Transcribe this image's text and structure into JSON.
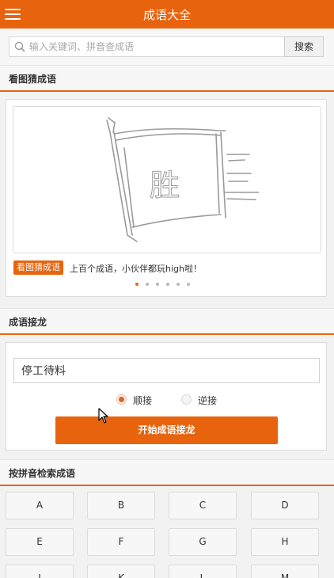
{
  "header": {
    "title": "成语大全",
    "menu_icon": "hamburger-menu-icon"
  },
  "search": {
    "placeholder": "输入关键词、拼音查成语",
    "value": "",
    "button_label": "搜索",
    "icon": "search-icon"
  },
  "guess_section": {
    "title": "看图猜成语",
    "puzzle_text": "胜",
    "tag_label": "看图猜成语",
    "caption": "上百个成语，小伙伴都玩high啦！",
    "carousel": {
      "count": 6,
      "active_index": 0
    }
  },
  "solitaire_section": {
    "title": "成语接龙",
    "input_value": "停工待料",
    "options": [
      {
        "label": "顺接",
        "selected": true
      },
      {
        "label": "逆接",
        "selected": false
      }
    ],
    "start_button_label": "开始成语接龙"
  },
  "pinyin_section": {
    "title": "按拼音检索成语",
    "letters": [
      "A",
      "B",
      "C",
      "D",
      "E",
      "F",
      "G",
      "H",
      "J",
      "K",
      "L",
      "M"
    ]
  },
  "colors": {
    "accent": "#e8630e",
    "background": "#f2f2f2"
  }
}
